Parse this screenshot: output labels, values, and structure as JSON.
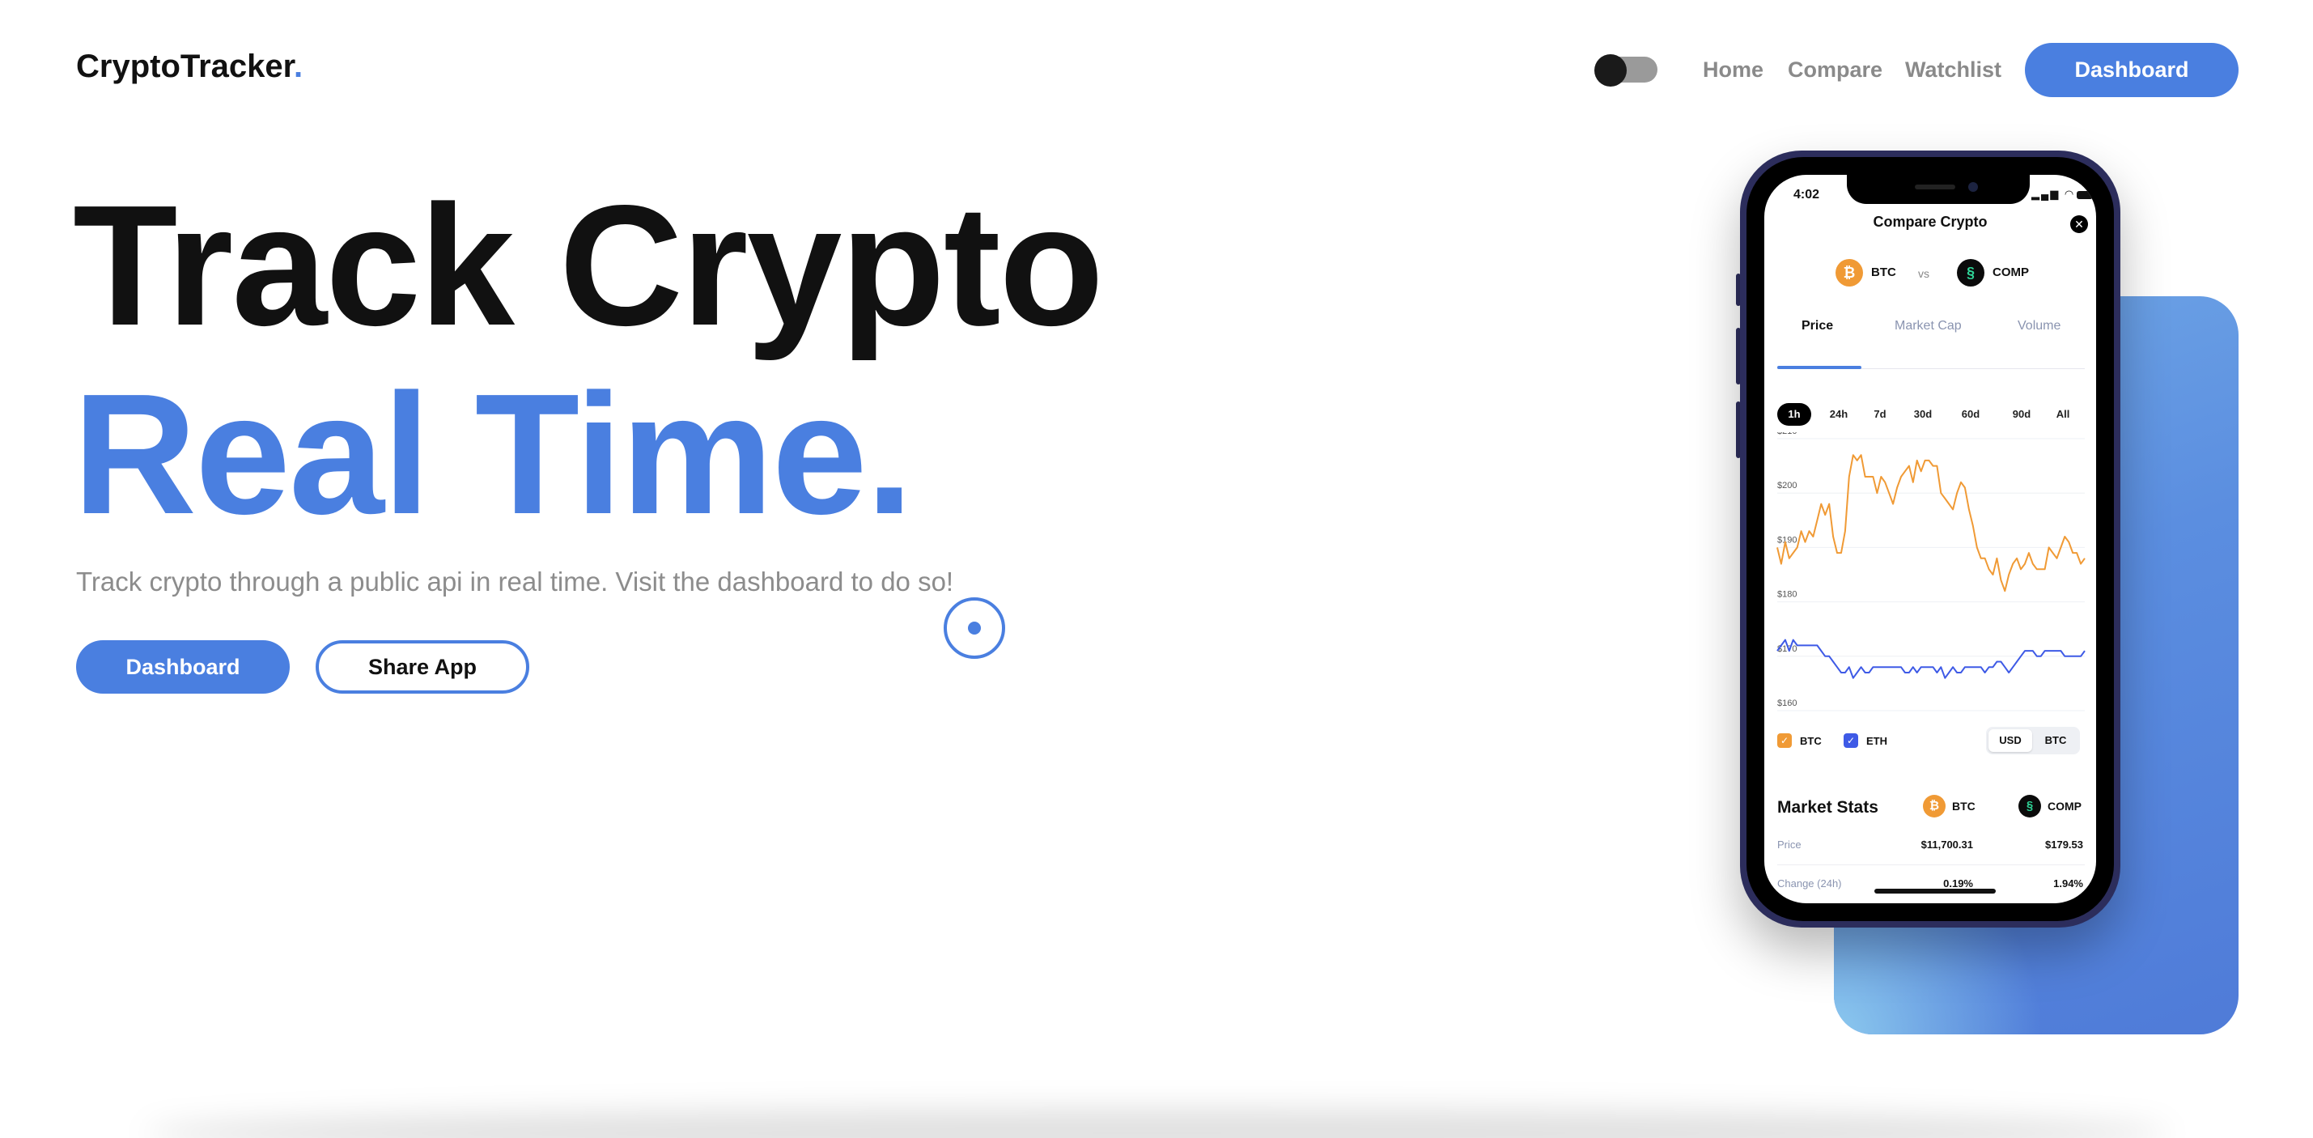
{
  "nav": {
    "logo_text": "CryptoTracker",
    "logo_dot": ".",
    "links": [
      "Home",
      "Compare",
      "Watchlist"
    ],
    "dashboard_label": "Dashboard",
    "theme_toggle": "toggle-icon"
  },
  "hero": {
    "title_line1": "Track Crypto",
    "title_line2": "Real Time.",
    "subtitle": "Track crypto through a public api in real time. Visit the dashboard to do so!",
    "primary_button": "Dashboard",
    "secondary_button": "Share App"
  },
  "colors": {
    "accent": "#4a7fe0",
    "btc": "#f09a35",
    "eth": "#3e5ae6",
    "text": "#111111",
    "muted": "#8c8c8c"
  },
  "phone": {
    "status_time": "4:02",
    "app_title": "Compare Crypto",
    "coin_a": "BTC",
    "coin_b": "COMP",
    "coin_a_icon": "bitcoin-icon",
    "coin_b_icon": "compound-icon",
    "vs": "vs",
    "tabs": [
      "Price",
      "Market Cap",
      "Volume"
    ],
    "active_tab": "Price",
    "ranges": [
      "1h",
      "24h",
      "7d",
      "30d",
      "60d",
      "90d",
      "All"
    ],
    "active_range": "1h",
    "legend": [
      "BTC",
      "ETH"
    ],
    "units": [
      "USD",
      "BTC"
    ],
    "active_unit": "USD",
    "stats_title": "Market Stats",
    "stats": [
      {
        "label": "Price",
        "a": "$11,700.31",
        "b": "$179.53"
      },
      {
        "label": "Change (24h)",
        "a": "0.19%",
        "b": "1.94%"
      }
    ]
  },
  "chart_data": {
    "type": "line",
    "title": "",
    "xlabel": "",
    "ylabel": "",
    "ylim": [
      160,
      210
    ],
    "yticks": [
      "$210",
      "$200",
      "$190",
      "$180",
      "$170",
      "$160"
    ],
    "grid": true,
    "legend": "bottom-left",
    "series": [
      {
        "name": "BTC",
        "color": "#f09a35",
        "values": [
          190,
          187,
          191,
          188,
          189,
          190,
          193,
          191,
          193,
          192,
          195,
          198,
          196,
          198,
          192,
          189,
          189,
          193,
          203,
          207,
          206,
          207,
          203,
          203,
          203,
          200,
          203,
          202,
          200,
          198,
          201,
          203,
          204,
          205,
          202,
          206,
          204,
          206,
          206,
          205,
          205,
          200,
          199,
          198,
          197,
          200,
          202,
          201,
          197,
          194,
          190,
          188,
          188,
          186,
          185,
          188,
          184,
          182,
          185,
          187,
          188,
          186,
          187,
          189,
          187,
          186,
          186,
          186,
          190,
          189,
          188,
          190,
          192,
          191,
          189,
          189,
          187,
          188
        ]
      },
      {
        "name": "ETH",
        "color": "#3e5ae6",
        "values": [
          171,
          172,
          173,
          171,
          173,
          172,
          172,
          172,
          172,
          172,
          172,
          171,
          170,
          170,
          169,
          168,
          167,
          167,
          168,
          166,
          167,
          168,
          167,
          167,
          168,
          168,
          168,
          168,
          168,
          168,
          168,
          168,
          167,
          167,
          168,
          167,
          168,
          168,
          168,
          168,
          167,
          168,
          166,
          167,
          168,
          167,
          167,
          168,
          168,
          168,
          168,
          168,
          167,
          168,
          168,
          169,
          169,
          168,
          167,
          168,
          169,
          170,
          171,
          171,
          171,
          170,
          170,
          171,
          171,
          171,
          171,
          171,
          170,
          170,
          170,
          170,
          170,
          171
        ]
      }
    ]
  }
}
